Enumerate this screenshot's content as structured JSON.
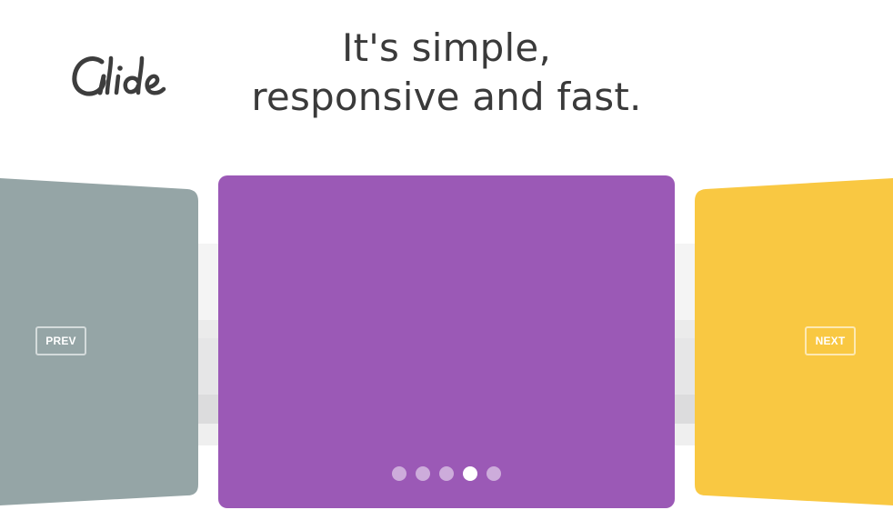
{
  "brand": {
    "logo_text": "Glide",
    "logo_color": "#3d3d3d"
  },
  "headline": {
    "line1": "It's simple,",
    "line2": "responsive and fast."
  },
  "carousel": {
    "slides": [
      {
        "name": "prev-slide",
        "color": "#95a5a6"
      },
      {
        "name": "active-slide",
        "color": "#9b59b6"
      },
      {
        "name": "next-slide",
        "color": "#f9c842"
      }
    ],
    "prev_label": "PREV",
    "next_label": "NEXT",
    "bullets": {
      "count": 5,
      "active_index": 3
    }
  }
}
